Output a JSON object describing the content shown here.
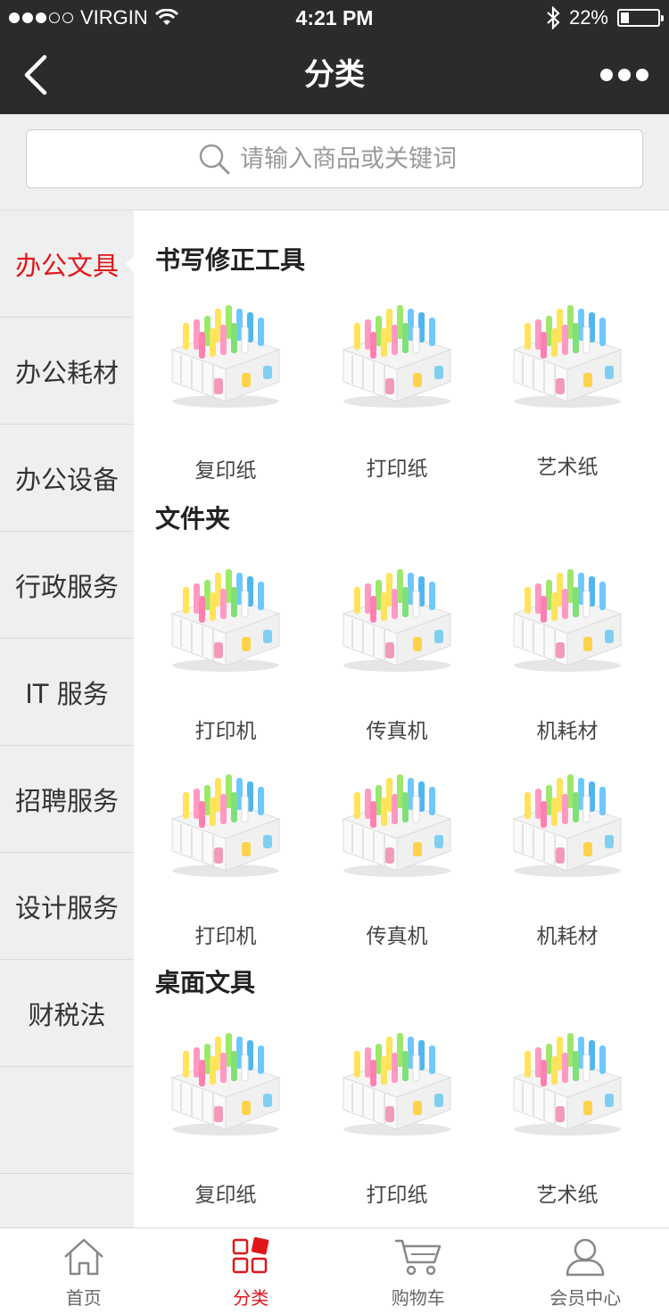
{
  "status_bar": {
    "carrier": "VIRGIN",
    "time": "4:21 PM",
    "battery": "22%",
    "battery_level": 0.22
  },
  "nav": {
    "title": "分类"
  },
  "search": {
    "placeholder": "请输入商品或关键词"
  },
  "sidebar": {
    "items": [
      {
        "label": "办公文具",
        "active": true
      },
      {
        "label": "办公耗材"
      },
      {
        "label": "办公设备"
      },
      {
        "label": "行政服务"
      },
      {
        "label": "IT 服务"
      },
      {
        "label": "招聘服务"
      },
      {
        "label": "设计服务"
      },
      {
        "label": "财税法"
      },
      {
        "label": ""
      },
      {
        "label": ""
      }
    ]
  },
  "sections": [
    {
      "title": "书写修正工具",
      "products": [
        "复印纸",
        "打印纸",
        "艺术纸"
      ]
    },
    {
      "title": "文件夹",
      "products": [
        "打印机",
        "传真机",
        "机耗材",
        "打印机",
        "传真机",
        "机耗材"
      ]
    },
    {
      "title": "桌面文具",
      "products": [
        "复印纸",
        "打印纸",
        "艺术纸"
      ]
    }
  ],
  "tab_bar": {
    "tabs": [
      {
        "label": "首页",
        "icon": "home-icon"
      },
      {
        "label": "分类",
        "icon": "category-icon",
        "active": true
      },
      {
        "label": "购物车",
        "icon": "cart-icon"
      },
      {
        "label": "会员中心",
        "icon": "user-icon"
      }
    ]
  },
  "colors": {
    "accent": "#e0161b",
    "header_bg": "#2b2b2b",
    "sidebar_bg": "#efefef"
  }
}
